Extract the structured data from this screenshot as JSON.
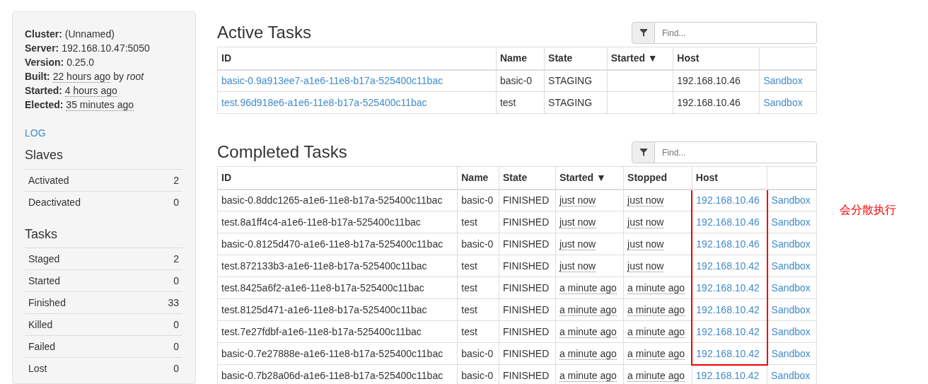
{
  "sidebar": {
    "info": [
      {
        "label": "Cluster:",
        "value": "(Unnamed)",
        "kind": "plain"
      },
      {
        "label": "Server:",
        "value": "192.168.10.47:5050",
        "kind": "plain"
      },
      {
        "label": "Version:",
        "value": "0.25.0",
        "kind": "plain"
      },
      {
        "label": "Built:",
        "value": "22 hours ago",
        "suffix": "by *root*",
        "kind": "time"
      },
      {
        "label": "Started:",
        "value": "4 hours ago",
        "kind": "time"
      },
      {
        "label": "Elected:",
        "value": "35 minutes ago",
        "kind": "time"
      }
    ],
    "log_link": "LOG",
    "sections": [
      {
        "title": "Slaves",
        "rows": [
          {
            "label": "Activated",
            "value": "2"
          },
          {
            "label": "Deactivated",
            "value": "0"
          }
        ]
      },
      {
        "title": "Tasks",
        "rows": [
          {
            "label": "Staged",
            "value": "2"
          },
          {
            "label": "Started",
            "value": "0"
          },
          {
            "label": "Finished",
            "value": "33"
          },
          {
            "label": "Killed",
            "value": "0"
          },
          {
            "label": "Failed",
            "value": "0"
          },
          {
            "label": "Lost",
            "value": "0"
          }
        ]
      }
    ]
  },
  "active_tasks": {
    "title": "Active Tasks",
    "filter": {
      "placeholder": "Find..."
    },
    "columns": [
      "ID",
      "Name",
      "State",
      "Started ▼",
      "Host",
      ""
    ],
    "rows": [
      {
        "id": "basic-0.9a913ee7-a1e6-11e8-b17a-525400c11bac",
        "name": "basic-0",
        "state": "STAGING",
        "started": "",
        "host": "192.168.10.46",
        "sandbox": "Sandbox"
      },
      {
        "id": "test.96d918e6-a1e6-11e8-b17a-525400c11bac",
        "name": "test",
        "state": "STAGING",
        "started": "",
        "host": "192.168.10.46",
        "sandbox": "Sandbox"
      }
    ]
  },
  "completed_tasks": {
    "title": "Completed Tasks",
    "filter": {
      "placeholder": "Find..."
    },
    "columns": [
      "ID",
      "Name",
      "State",
      "Started ▼",
      "Stopped",
      "Host",
      ""
    ],
    "rows": [
      {
        "id": "basic-0.8ddc1265-a1e6-11e8-b17a-525400c11bac",
        "name": "basic-0",
        "state": "FINISHED",
        "started": "just now",
        "stopped": "just now",
        "host": "192.168.10.46",
        "sandbox": "Sandbox",
        "highlighted": true
      },
      {
        "id": "test.8a1ff4c4-a1e6-11e8-b17a-525400c11bac",
        "name": "test",
        "state": "FINISHED",
        "started": "just now",
        "stopped": "just now",
        "host": "192.168.10.46",
        "sandbox": "Sandbox",
        "highlighted": true
      },
      {
        "id": "basic-0.8125d470-a1e6-11e8-b17a-525400c11bac",
        "name": "basic-0",
        "state": "FINISHED",
        "started": "just now",
        "stopped": "just now",
        "host": "192.168.10.46",
        "sandbox": "Sandbox",
        "highlighted": true
      },
      {
        "id": "test.872133b3-a1e6-11e8-b17a-525400c11bac",
        "name": "test",
        "state": "FINISHED",
        "started": "just now",
        "stopped": "just now",
        "host": "192.168.10.42",
        "sandbox": "Sandbox",
        "highlighted": true
      },
      {
        "id": "test.8425a6f2-a1e6-11e8-b17a-525400c11bac",
        "name": "test",
        "state": "FINISHED",
        "started": "a minute ago",
        "stopped": "a minute ago",
        "host": "192.168.10.42",
        "sandbox": "Sandbox",
        "highlighted": true
      },
      {
        "id": "test.8125d471-a1e6-11e8-b17a-525400c11bac",
        "name": "test",
        "state": "FINISHED",
        "started": "a minute ago",
        "stopped": "a minute ago",
        "host": "192.168.10.42",
        "sandbox": "Sandbox",
        "highlighted": true
      },
      {
        "id": "test.7e27fdbf-a1e6-11e8-b17a-525400c11bac",
        "name": "test",
        "state": "FINISHED",
        "started": "a minute ago",
        "stopped": "a minute ago",
        "host": "192.168.10.42",
        "sandbox": "Sandbox",
        "highlighted": true
      },
      {
        "id": "basic-0.7e27888e-a1e6-11e8-b17a-525400c11bac",
        "name": "basic-0",
        "state": "FINISHED",
        "started": "a minute ago",
        "stopped": "a minute ago",
        "host": "192.168.10.42",
        "sandbox": "Sandbox",
        "highlighted": true
      },
      {
        "id": "basic-0.7b28a06d-a1e6-11e8-b17a-525400c11bac",
        "name": "basic-0",
        "state": "FINISHED",
        "started": "a minute ago",
        "stopped": "a minute ago",
        "host": "192.168.10.42",
        "sandbox": "Sandbox",
        "highlighted": false
      }
    ]
  },
  "annotation": {
    "text": "会分散执行"
  }
}
